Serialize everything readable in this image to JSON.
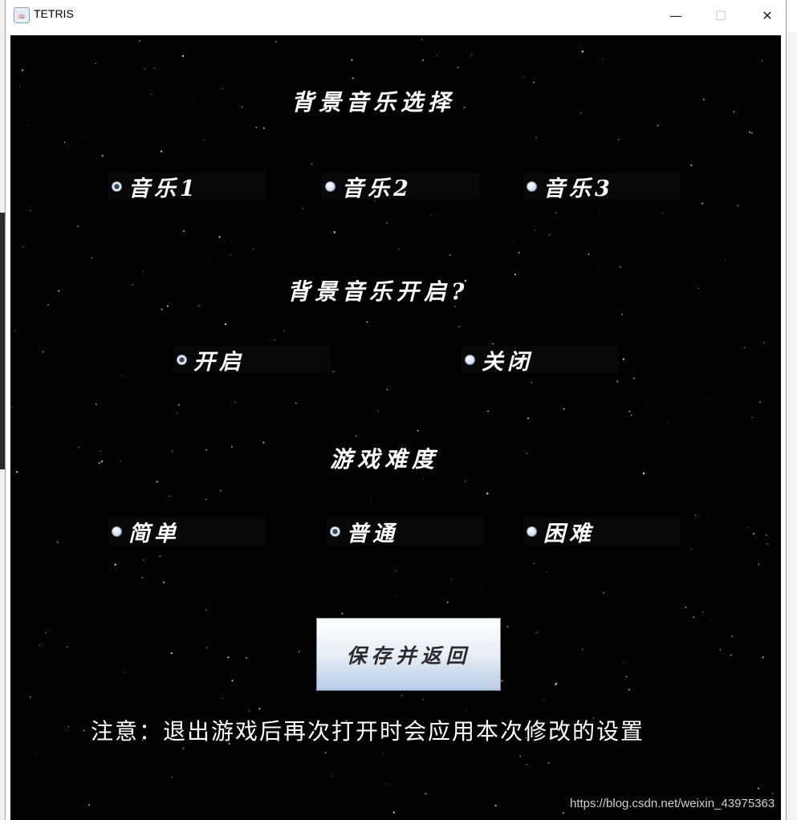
{
  "window": {
    "title": "TETRIS",
    "minimize_glyph": "—",
    "maximize_glyph": "☐",
    "close_glyph": "✕"
  },
  "music_select": {
    "heading": "背景音乐选择",
    "options": [
      {
        "label": "音乐1",
        "checked": true
      },
      {
        "label": "音乐2",
        "checked": false
      },
      {
        "label": "音乐3",
        "checked": false
      }
    ]
  },
  "music_toggle": {
    "heading": "背景音乐开启?",
    "options": [
      {
        "label": "开启",
        "checked": true
      },
      {
        "label": "关闭",
        "checked": false
      }
    ]
  },
  "difficulty": {
    "heading": "游戏难度",
    "options": [
      {
        "label": "简单",
        "checked": false
      },
      {
        "label": "普通",
        "checked": true
      },
      {
        "label": "困难",
        "checked": false
      }
    ]
  },
  "save_button": {
    "label": "保存并返回"
  },
  "notice": "注意：退出游戏后再次打开时会应用本次修改的设置",
  "watermark": "https://blog.csdn.net/weixin_43975363"
}
